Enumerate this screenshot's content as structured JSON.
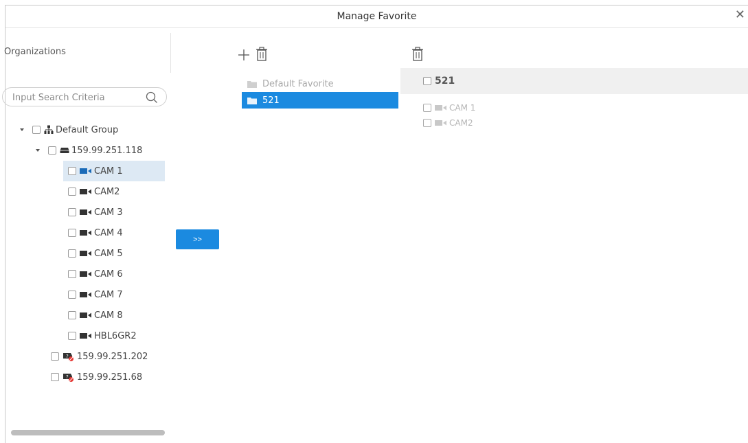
{
  "dialog": {
    "title": "Manage Favorite",
    "close_symbol": "✕"
  },
  "left_panel": {
    "label": "Organizations",
    "search": {
      "placeholder": "Input Search Criteria",
      "value": ""
    },
    "tree": [
      {
        "label": "Default Group",
        "icon": "org-tree-icon",
        "level": 0,
        "expanded": true
      },
      {
        "label": "159.99.251.118",
        "icon": "nvr-device-icon",
        "level": 1,
        "expanded": true
      },
      {
        "label": "CAM 1",
        "icon": "camera-icon",
        "level": 2,
        "selected": true
      },
      {
        "label": "CAM2",
        "icon": "camera-icon",
        "level": 2
      },
      {
        "label": "CAM 3",
        "icon": "camera-icon",
        "level": 2
      },
      {
        "label": "CAM 4",
        "icon": "camera-icon",
        "level": 2
      },
      {
        "label": "CAM 5",
        "icon": "camera-icon",
        "level": 2
      },
      {
        "label": "CAM 6",
        "icon": "camera-icon",
        "level": 2
      },
      {
        "label": "CAM 7",
        "icon": "camera-icon",
        "level": 2
      },
      {
        "label": "CAM 8",
        "icon": "camera-icon",
        "level": 2
      },
      {
        "label": "HBL6GR2",
        "icon": "camera-icon",
        "level": 2
      },
      {
        "label": "159.99.251.202",
        "icon": "offline-device-icon",
        "level": 1
      },
      {
        "label": "159.99.251.68",
        "icon": "offline-device-icon",
        "level": 1
      }
    ]
  },
  "transfer_button": {
    "label": ">>"
  },
  "favorites_panel": {
    "toolbar": [
      "add-icon",
      "delete-icon"
    ],
    "items": [
      {
        "label": "Default Favorite",
        "selected": false
      },
      {
        "label": "521",
        "selected": true
      }
    ]
  },
  "detail_panel": {
    "toolbar": [
      "delete-icon"
    ],
    "header": "521",
    "children": [
      {
        "label": "CAM 1",
        "icon": "camera-icon"
      },
      {
        "label": "CAM2",
        "icon": "camera-icon"
      }
    ]
  },
  "colors": {
    "accent": "#1b8ae0",
    "selected_row": "#dde9f4",
    "header_bg": "#f0f0f0",
    "offline_badge": "#e53935"
  }
}
